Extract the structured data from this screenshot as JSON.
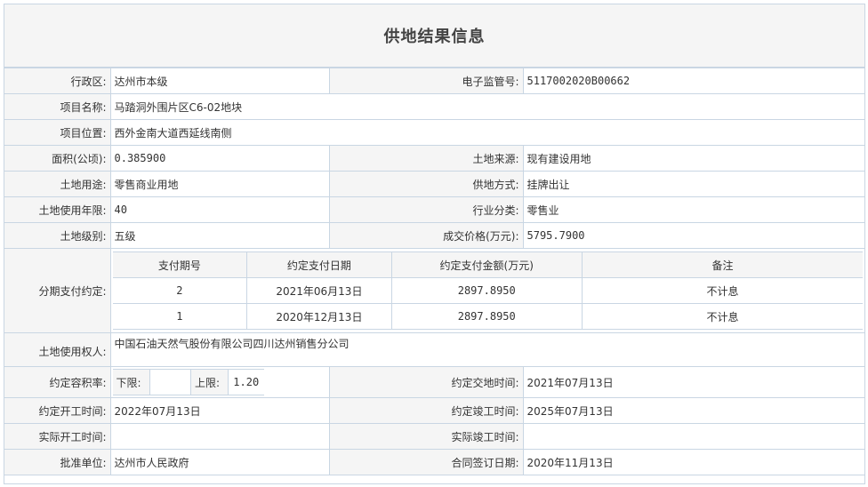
{
  "title": "供地结果信息",
  "rows": {
    "admin_region": {
      "label": "行政区:",
      "value": "达州市本级"
    },
    "e_supervision_no": {
      "label": "电子监管号:",
      "value": "5117002020B00662"
    },
    "project_name": {
      "label": "项目名称:",
      "value": "马踏洞外围片区C6-02地块"
    },
    "project_location": {
      "label": "项目位置:",
      "value": "西外金南大道西延线南侧"
    },
    "area": {
      "label": "面积(公顷):",
      "value": "0.385900"
    },
    "land_source": {
      "label": "土地来源:",
      "value": "现有建设用地"
    },
    "land_use": {
      "label": "土地用途:",
      "value": "零售商业用地"
    },
    "supply_method": {
      "label": "供地方式:",
      "value": "挂牌出让"
    },
    "use_years": {
      "label": "土地使用年限:",
      "value": "40"
    },
    "industry": {
      "label": "行业分类:",
      "value": "零售业"
    },
    "land_grade": {
      "label": "土地级别:",
      "value": "五级"
    },
    "price": {
      "label": "成交价格(万元):",
      "value": "5795.7900"
    },
    "installment": {
      "label": "分期支付约定:",
      "headers": [
        "支付期号",
        "约定支付日期",
        "约定支付金额(万元)",
        "备注"
      ],
      "items": [
        {
          "period": "2",
          "date": "2021年06月13日",
          "amount": "2897.8950",
          "note": "不计息"
        },
        {
          "period": "1",
          "date": "2020年12月13日",
          "amount": "2897.8950",
          "note": "不计息"
        }
      ]
    },
    "land_user": {
      "label": "土地使用权人:",
      "value": "中国石油天然气股份有限公司四川达州销售分公司"
    },
    "far": {
      "label": "约定容积率:",
      "lower_label": "下限:",
      "lower_value": "",
      "upper_label": "上限:",
      "upper_value": "1.20"
    },
    "delivery_time": {
      "label": "约定交地时间:",
      "value": "2021年07月13日"
    },
    "start_time": {
      "label": "约定开工时间:",
      "value": "2022年07月13日"
    },
    "finish_time": {
      "label": "约定竣工时间:",
      "value": "2025年07月13日"
    },
    "actual_start": {
      "label": "实际开工时间:",
      "value": ""
    },
    "actual_finish": {
      "label": "实际竣工时间:",
      "value": ""
    },
    "approval_unit": {
      "label": "批准单位:",
      "value": "达州市人民政府"
    },
    "contract_date": {
      "label": "合同签订日期:",
      "value": "2020年11月13日"
    }
  }
}
